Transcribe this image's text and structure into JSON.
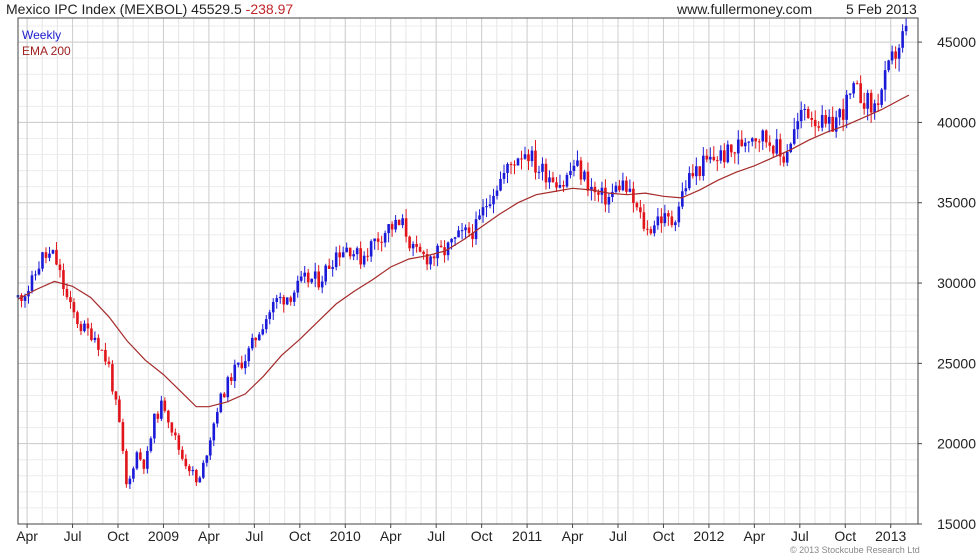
{
  "header": {
    "title": "Mexico IPC Index (MEXBOL) 45529.5",
    "change": "-238.97",
    "site": "www.fullermoney.com",
    "date": "5 Feb 2013"
  },
  "footer": {
    "copyright": "© 2013 Stockcube Research Ltd"
  },
  "chart_data": {
    "type": "candlestick",
    "title": "Mexico IPC Index (MEXBOL) 45529.5 -238.97",
    "ylim": [
      15000,
      46500
    ],
    "y_ticks": [
      15000,
      20000,
      25000,
      30000,
      35000,
      40000,
      45000
    ],
    "y_axis_side": "right",
    "x_range": [
      2008.2,
      2013.15
    ],
    "x_ticks": [
      {
        "label": "Apr",
        "t": 2008.25
      },
      {
        "label": "Jul",
        "t": 2008.5
      },
      {
        "label": "Oct",
        "t": 2008.75
      },
      {
        "label": "2009",
        "t": 2009.0
      },
      {
        "label": "Apr",
        "t": 2009.25
      },
      {
        "label": "Jul",
        "t": 2009.5
      },
      {
        "label": "Oct",
        "t": 2009.75
      },
      {
        "label": "2010",
        "t": 2010.0
      },
      {
        "label": "Apr",
        "t": 2010.25
      },
      {
        "label": "Jul",
        "t": 2010.5
      },
      {
        "label": "Oct",
        "t": 2010.75
      },
      {
        "label": "2011",
        "t": 2011.0
      },
      {
        "label": "Apr",
        "t": 2011.25
      },
      {
        "label": "Jul",
        "t": 2011.5
      },
      {
        "label": "Oct",
        "t": 2011.75
      },
      {
        "label": "2012",
        "t": 2012.0
      },
      {
        "label": "Apr",
        "t": 2012.25
      },
      {
        "label": "Jul",
        "t": 2012.5
      },
      {
        "label": "Oct",
        "t": 2012.75
      },
      {
        "label": "2013",
        "t": 2013.0
      }
    ],
    "grid": true,
    "legend_position": "top-left",
    "series": [
      {
        "name": "Weekly",
        "kind": "candle",
        "color_up": "#1a1ad8",
        "color_down": "#e0141a",
        "anchors": [
          [
            2008.2,
            29100
          ],
          [
            2008.27,
            29800
          ],
          [
            2008.33,
            31600
          ],
          [
            2008.4,
            31700
          ],
          [
            2008.48,
            28600
          ],
          [
            2008.55,
            27200
          ],
          [
            2008.62,
            26800
          ],
          [
            2008.7,
            24800
          ],
          [
            2008.76,
            21000
          ],
          [
            2008.8,
            17000
          ],
          [
            2008.85,
            19500
          ],
          [
            2008.9,
            18600
          ],
          [
            2008.95,
            21500
          ],
          [
            2009.0,
            22600
          ],
          [
            2009.05,
            20800
          ],
          [
            2009.1,
            19200
          ],
          [
            2009.16,
            18200
          ],
          [
            2009.19,
            17300
          ],
          [
            2009.24,
            19600
          ],
          [
            2009.3,
            22400
          ],
          [
            2009.38,
            24400
          ],
          [
            2009.46,
            25500
          ],
          [
            2009.55,
            27600
          ],
          [
            2009.62,
            28900
          ],
          [
            2009.7,
            29300
          ],
          [
            2009.78,
            30200
          ],
          [
            2009.86,
            30200
          ],
          [
            2009.95,
            31900
          ],
          [
            2010.02,
            32300
          ],
          [
            2010.08,
            31500
          ],
          [
            2010.16,
            32600
          ],
          [
            2010.24,
            33500
          ],
          [
            2010.32,
            33600
          ],
          [
            2010.38,
            31800
          ],
          [
            2010.46,
            31600
          ],
          [
            2010.55,
            32000
          ],
          [
            2010.62,
            32800
          ],
          [
            2010.72,
            33400
          ],
          [
            2010.8,
            35600
          ],
          [
            2010.87,
            36700
          ],
          [
            2010.95,
            38000
          ],
          [
            2011.0,
            38300
          ],
          [
            2011.05,
            37200
          ],
          [
            2011.12,
            36800
          ],
          [
            2011.2,
            36200
          ],
          [
            2011.26,
            37400
          ],
          [
            2011.32,
            36500
          ],
          [
            2011.38,
            35400
          ],
          [
            2011.45,
            35300
          ],
          [
            2011.52,
            36300
          ],
          [
            2011.58,
            35100
          ],
          [
            2011.66,
            33200
          ],
          [
            2011.72,
            34100
          ],
          [
            2011.8,
            33800
          ],
          [
            2011.88,
            36400
          ],
          [
            2011.96,
            37300
          ],
          [
            2012.05,
            37900
          ],
          [
            2012.13,
            38100
          ],
          [
            2012.22,
            39300
          ],
          [
            2012.28,
            39200
          ],
          [
            2012.36,
            38700
          ],
          [
            2012.4,
            37600
          ],
          [
            2012.46,
            39200
          ],
          [
            2012.53,
            40900
          ],
          [
            2012.6,
            40100
          ],
          [
            2012.65,
            39500
          ],
          [
            2012.72,
            40500
          ],
          [
            2012.8,
            41900
          ],
          [
            2012.85,
            41600
          ],
          [
            2012.9,
            40700
          ],
          [
            2012.96,
            42300
          ],
          [
            2013.02,
            44200
          ],
          [
            2013.08,
            45600
          ],
          [
            2013.1,
            45500
          ]
        ]
      },
      {
        "name": "EMA 200",
        "kind": "line",
        "color": "#a52a2a",
        "points": [
          [
            2008.2,
            29000
          ],
          [
            2008.3,
            29600
          ],
          [
            2008.4,
            30100
          ],
          [
            2008.5,
            29800
          ],
          [
            2008.6,
            29100
          ],
          [
            2008.7,
            27900
          ],
          [
            2008.8,
            26400
          ],
          [
            2008.9,
            25200
          ],
          [
            2009.0,
            24300
          ],
          [
            2009.1,
            23200
          ],
          [
            2009.18,
            22300
          ],
          [
            2009.25,
            22300
          ],
          [
            2009.35,
            22600
          ],
          [
            2009.45,
            23100
          ],
          [
            2009.55,
            24200
          ],
          [
            2009.65,
            25500
          ],
          [
            2009.75,
            26500
          ],
          [
            2009.85,
            27600
          ],
          [
            2009.95,
            28700
          ],
          [
            2010.05,
            29500
          ],
          [
            2010.15,
            30200
          ],
          [
            2010.25,
            31000
          ],
          [
            2010.35,
            31500
          ],
          [
            2010.45,
            31700
          ],
          [
            2010.55,
            32000
          ],
          [
            2010.65,
            32700
          ],
          [
            2010.75,
            33500
          ],
          [
            2010.85,
            34300
          ],
          [
            2010.95,
            35000
          ],
          [
            2011.05,
            35500
          ],
          [
            2011.15,
            35700
          ],
          [
            2011.25,
            35900
          ],
          [
            2011.35,
            35800
          ],
          [
            2011.45,
            35600
          ],
          [
            2011.55,
            35500
          ],
          [
            2011.65,
            35600
          ],
          [
            2011.75,
            35400
          ],
          [
            2011.85,
            35300
          ],
          [
            2011.95,
            35800
          ],
          [
            2012.05,
            36400
          ],
          [
            2012.15,
            36900
          ],
          [
            2012.25,
            37300
          ],
          [
            2012.35,
            37800
          ],
          [
            2012.45,
            38300
          ],
          [
            2012.55,
            38900
          ],
          [
            2012.65,
            39400
          ],
          [
            2012.75,
            39800
          ],
          [
            2012.85,
            40300
          ],
          [
            2012.95,
            40800
          ],
          [
            2013.05,
            41400
          ],
          [
            2013.1,
            41700
          ]
        ]
      }
    ]
  }
}
